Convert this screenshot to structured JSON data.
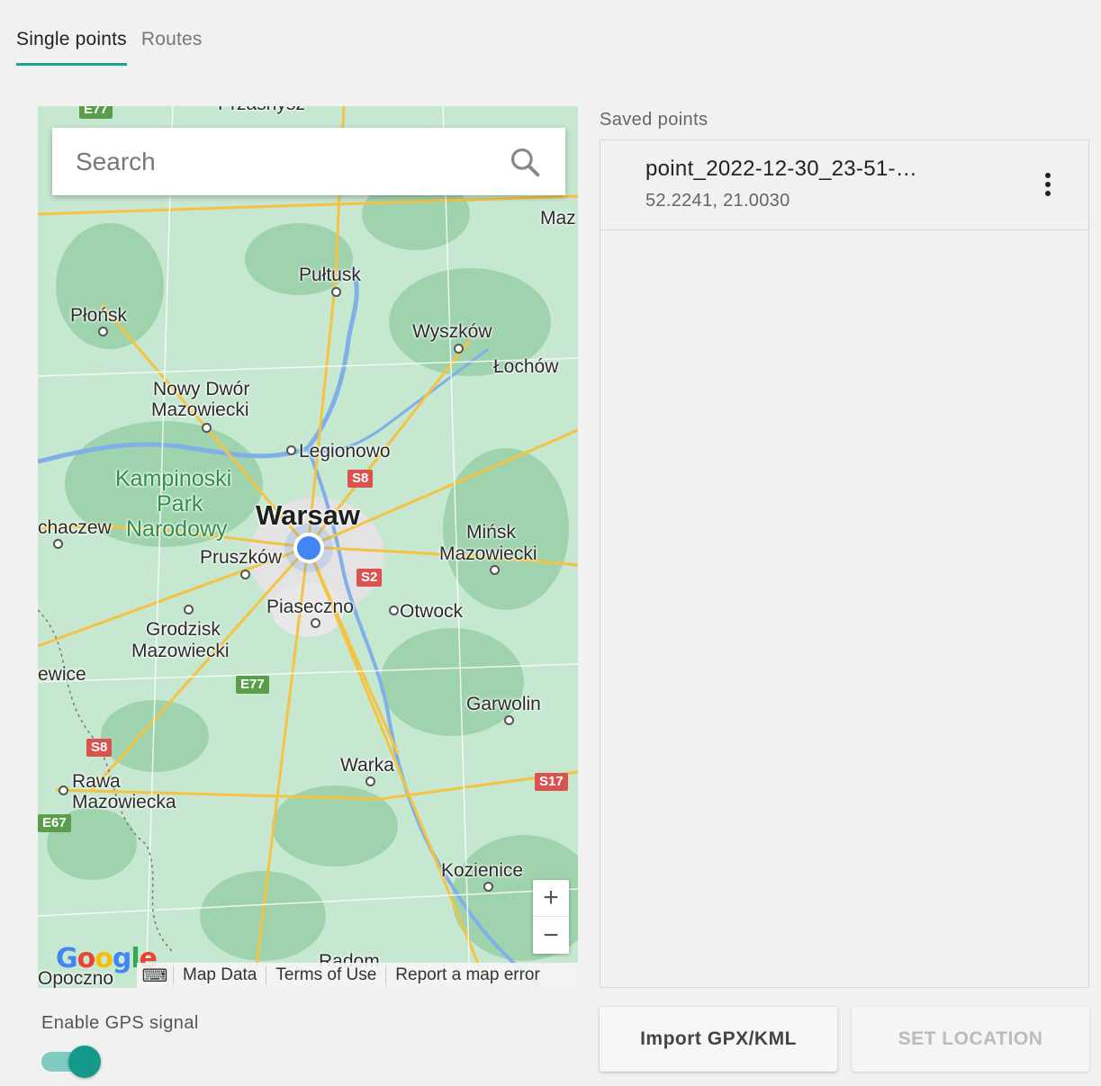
{
  "tabs": [
    {
      "label": "Single points",
      "active": true
    },
    {
      "label": "Routes",
      "active": false
    }
  ],
  "map": {
    "search_placeholder": "Search",
    "places": {
      "pultusk": "Pułtusk",
      "plonsk": "Płońsk",
      "wyszkow": "Wyszków",
      "lochow": "Łochów",
      "nowy_dwor_1": "Nowy Dwór",
      "nowy_dwor_2": "Mazowiecki",
      "legionowo": "Legionowo",
      "kampinoski_1": "Kampinoski",
      "kampinoski_2": "Park",
      "kampinoski_3": "Narodowy",
      "warsaw": "Warsaw",
      "sochaczew": "chaczew",
      "minsk_1": "Mińsk",
      "minsk_2": "Mazowiecki",
      "pruszkow": "Pruszków",
      "piaseczno": "Piaseczno",
      "otwock": "Otwock",
      "grodzisk_1": "Grodzisk",
      "grodzisk_2": "Mazowiecki",
      "skierniewice": "ewice",
      "garwolin": "Garwolin",
      "warka": "Warka",
      "rawa_1": "Rawa",
      "rawa_2": "Mazowiecka",
      "kozienice": "Kozienice",
      "radom": "Radom",
      "opoczno": "Opoczno",
      "maz_edge": "Maz",
      "top_town": "Przasnysz"
    },
    "shields": {
      "s8_top": "S8",
      "s2": "S2",
      "e77_mid": "E77",
      "s8_left": "S8",
      "s17": "S17",
      "e67": "E67",
      "e77_top": "E77"
    },
    "google_logo": "Google",
    "keyboard_icon": "keyboard-icon",
    "attribution": {
      "map_data": "Map Data",
      "terms": "Terms of Use",
      "report": "Report a map error"
    },
    "zoom_in": "+",
    "zoom_out": "−"
  },
  "gps": {
    "label": "Enable GPS signal",
    "enabled": true
  },
  "saved": {
    "label": "Saved points",
    "items": [
      {
        "name": "point_2022-12-30_23-51-…",
        "coords": "52.2241, 21.0030"
      }
    ]
  },
  "buttons": {
    "import": "Import GPX/KML",
    "set_location": "SET LOCATION"
  },
  "colors": {
    "accent": "#1aa394",
    "gps_dot": "#4285f4"
  }
}
